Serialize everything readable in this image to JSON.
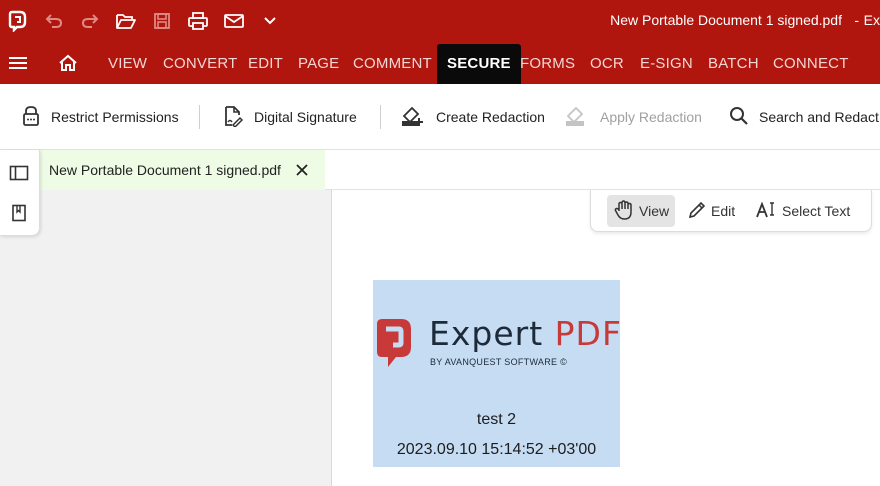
{
  "window": {
    "title": "New Portable Document 1 signed.pdf",
    "title_dash": "-",
    "app_name_partial": "Ex"
  },
  "quick_access": {
    "icons": [
      "app-logo-icon",
      "undo-icon",
      "redo-icon",
      "open-folder-icon",
      "save-icon",
      "print-icon",
      "email-icon",
      "chevron-down-icon"
    ]
  },
  "menu": {
    "tabs": [
      {
        "label": "VIEW"
      },
      {
        "label": "CONVERT"
      },
      {
        "label": "EDIT"
      },
      {
        "label": "PAGE"
      },
      {
        "label": "COMMENT"
      },
      {
        "label": "SECURE"
      },
      {
        "label": "FORMS"
      },
      {
        "label": "OCR"
      },
      {
        "label": "E-SIGN"
      },
      {
        "label": "BATCH"
      },
      {
        "label": "CONNECT"
      }
    ],
    "active_tab": "SECURE"
  },
  "toolbar": {
    "restrict_permissions": "Restrict Permissions",
    "digital_signature": "Digital Signature",
    "create_redaction": "Create Redaction",
    "apply_redaction": "Apply Redaction",
    "search_and_redact": "Search and Redact"
  },
  "document_tab": {
    "label": "New Portable Document 1 signed.pdf"
  },
  "view_modes": {
    "view": "View",
    "edit": "Edit",
    "select_text": "Select Text",
    "active": "View"
  },
  "signature": {
    "brand_main": "Expert",
    "brand_pdf": "PDF",
    "brand_sub": "BY AVANQUEST SOFTWARE ©",
    "signer": "test 2",
    "datetime": "2023.09.10 15:14:52 +03'00"
  },
  "colors": {
    "brand_red": "#b0150e",
    "active_tab_bg": "#0a0a0a",
    "doc_tab_bg": "#eefbe5",
    "signature_bg": "#c6dcf2",
    "logo_red": "#c83a3a"
  }
}
